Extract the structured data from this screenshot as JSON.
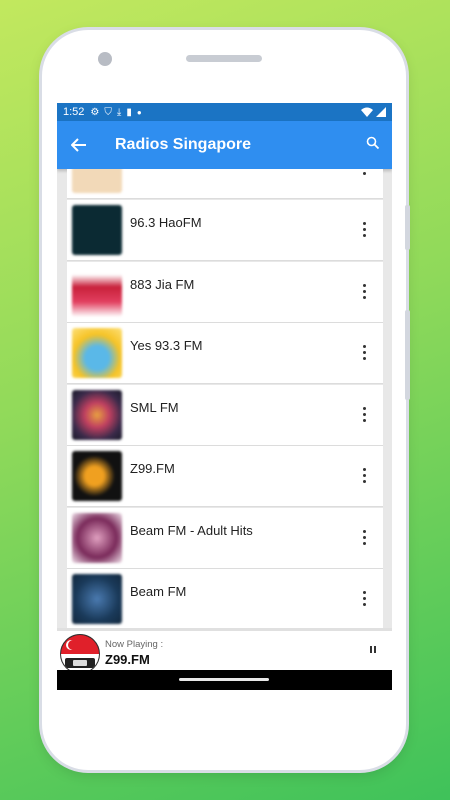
{
  "status_bar": {
    "time": "1:52",
    "icons": [
      "gear-icon",
      "shield-icon",
      "download-icon",
      "sd-card-icon",
      "dot-icon"
    ],
    "right_icons": [
      "wifi-icon",
      "signal-icon"
    ]
  },
  "app_bar": {
    "title": "Radios Singapore",
    "back_icon": "arrow-back-icon",
    "search_icon": "search-icon",
    "color": "#2f8ef0"
  },
  "stations": [
    {
      "name": "96.3 HaoFM",
      "thumb_color": "#0b2a33"
    },
    {
      "name": "883 Jia FM",
      "thumb_color": "#c8203a"
    },
    {
      "name": "Yes 93.3 FM",
      "thumb_color": "#f6c325"
    },
    {
      "name": "SML FM",
      "thumb_color": "#3a2a4a"
    },
    {
      "name": "Z99.FM",
      "thumb_color": "#111111"
    },
    {
      "name": "Beam FM - Adult Hits",
      "thumb_color": "#7a2a5a"
    },
    {
      "name": "Beam FM",
      "thumb_color": "#1a3a5a"
    }
  ],
  "player": {
    "label": "Now Playing :",
    "station": "Z99.FM",
    "pause_icon": "pause-icon"
  }
}
